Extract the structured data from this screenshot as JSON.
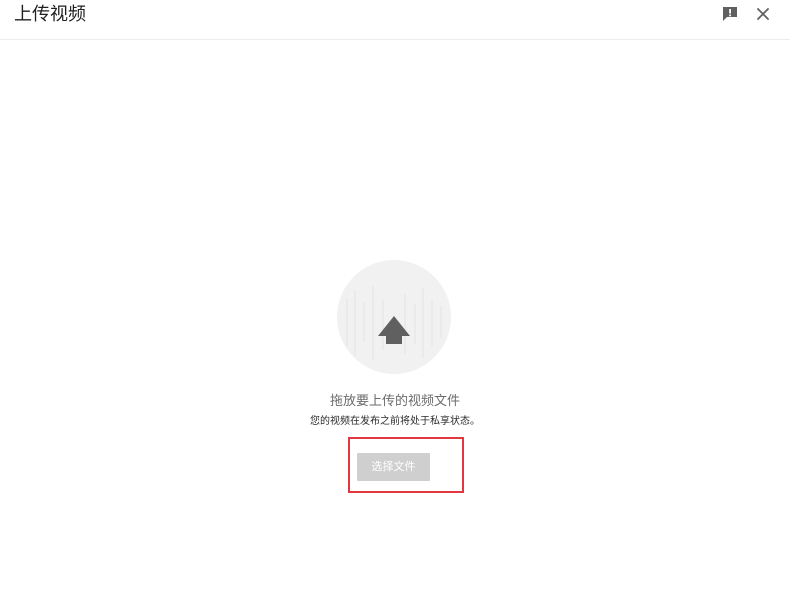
{
  "dialog": {
    "title": "上传视频"
  },
  "upload": {
    "drop_text": "拖放要上传的视频文件",
    "privacy_text": "您的视频在发布之前将处于私享状态。",
    "select_button_label": "选择文件"
  },
  "colors": {
    "highlight_border": "#e0383e",
    "button_disabled_bg": "#cfcfcf",
    "icon_gray": "#606060"
  }
}
